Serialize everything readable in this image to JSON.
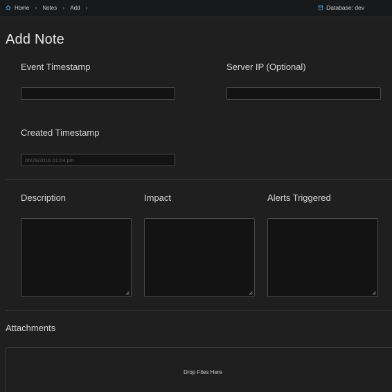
{
  "breadcrumbs": [
    "Home",
    "Notes",
    "Add"
  ],
  "database_label": "Database: dev",
  "page_title": "Add Note",
  "fields": {
    "event_timestamp": {
      "label": "Event Timestamp",
      "value": ""
    },
    "server_ip": {
      "label": "Server IP (Optional)",
      "value": ""
    },
    "created_timestamp": {
      "label": "Created Timestamp",
      "placeholder": "06/28/2016 01:04 pm"
    },
    "description": {
      "label": "Description"
    },
    "impact": {
      "label": "Impact"
    },
    "alerts_triggered": {
      "label": "Alerts Triggered"
    }
  },
  "attachments": {
    "label": "Attachments",
    "drop_text": "Drop Files Here"
  },
  "colors": {
    "background": "#1f1f20",
    "topbar": "#18191a",
    "field_bg": "#131314",
    "accent_icon": "#4aa3df"
  },
  "icons": {
    "home": "home-icon",
    "database": "database-icon",
    "separator": "chevron-right-icon",
    "resize": "resize-grip-icon"
  }
}
